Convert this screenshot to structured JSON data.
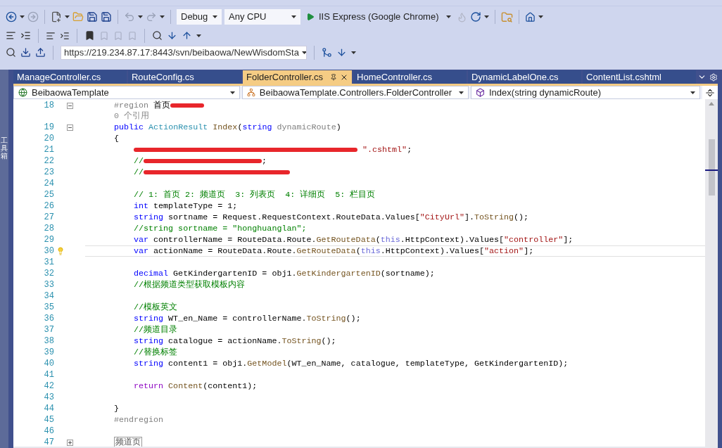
{
  "toolbar": {
    "config": "Debug",
    "platform": "Any CPU",
    "run_target": "IIS Express (Google Chrome)",
    "svn_url": "https://219.234.87.17:8443/svn/beibaowa/NewWisdomSta"
  },
  "side_panel": {
    "label": "工具箱"
  },
  "tabs": [
    {
      "label": "ManageController.cs",
      "selected": false
    },
    {
      "label": "RouteConfig.cs",
      "selected": false
    },
    {
      "label": "FolderController.cs",
      "selected": true
    },
    {
      "label": "HomeController.cs",
      "selected": false
    },
    {
      "label": "DynamicLabelOne.cs",
      "selected": false
    },
    {
      "label": "ContentList.cshtml",
      "selected": false
    }
  ],
  "nav_bar": [
    {
      "kind": "project",
      "label": "BeibaowaTemplate"
    },
    {
      "kind": "class",
      "label": "BeibaowaTemplate.Controllers.FolderController"
    },
    {
      "kind": "method",
      "label": "Index(string dynamicRoute)"
    }
  ],
  "code_lines": [
    {
      "number": "18",
      "expanded": true,
      "tokens": [
        {
          "kind": "pre",
          "text": "#region "
        },
        {
          "kind": "plain",
          "text": "首页"
        },
        {
          "kind": "redaction"
        }
      ]
    },
    {
      "kind": "codelens",
      "text": "0 个引用"
    },
    {
      "number": "19",
      "expanded": true,
      "tokens": [
        {
          "kind": "kw",
          "text": "public "
        },
        {
          "kind": "type",
          "text": "ActionResult "
        },
        {
          "kind": "method",
          "text": "Index"
        },
        {
          "kind": "plain",
          "text": "("
        },
        {
          "kind": "kw",
          "text": "string "
        },
        {
          "kind": "param",
          "text": "dynamicRoute"
        },
        {
          "kind": "plain",
          "text": ")"
        }
      ]
    },
    {
      "number": "20",
      "tokens": [
        {
          "kind": "plain",
          "text": "{"
        }
      ],
      "children": [
        {
          "number": "21",
          "tokens": [
            {
              "kind": "redaction"
            },
            {
              "kind": "str",
              "text": " \".cshtml\""
            },
            {
              "kind": "plain",
              "text": ";"
            }
          ]
        },
        {
          "number": "22",
          "tokens": [
            {
              "kind": "cm",
              "text": "//"
            },
            {
              "kind": "redaction"
            },
            {
              "kind": "plain",
              "text": ";"
            }
          ]
        },
        {
          "number": "23",
          "tokens": [
            {
              "kind": "cm",
              "text": "//"
            },
            {
              "kind": "redaction"
            }
          ]
        },
        {
          "number": "24"
        },
        {
          "number": "25",
          "tokens": [
            {
              "kind": "cm",
              "text": "// 1: 首页 2: 频道页  3: 列表页  4: 详细页  5: 栏目页"
            }
          ]
        },
        {
          "number": "26",
          "tokens": [
            {
              "kind": "kw",
              "text": "int "
            },
            {
              "kind": "plain",
              "text": "templateType = 1;"
            }
          ]
        },
        {
          "number": "27",
          "tokens": [
            {
              "kind": "kw",
              "text": "string "
            },
            {
              "kind": "plain",
              "text": "sortname = Request.RequestContext.RouteData.Values["
            },
            {
              "kind": "str",
              "text": "\"CityUrl\""
            },
            {
              "kind": "plain",
              "text": "]."
            },
            {
              "kind": "method",
              "text": "ToString"
            },
            {
              "kind": "plain",
              "text": "();"
            }
          ]
        },
        {
          "number": "28",
          "tokens": [
            {
              "kind": "cm",
              "text": "//string sortname = \"honghuanglan\";"
            }
          ]
        },
        {
          "number": "29",
          "tokens": [
            {
              "kind": "kw",
              "text": "var "
            },
            {
              "kind": "plain",
              "text": "controllerName = RouteData.Route."
            },
            {
              "kind": "method",
              "text": "GetRouteData"
            },
            {
              "kind": "plain",
              "text": "("
            },
            {
              "kind": "this",
              "text": "this"
            },
            {
              "kind": "plain",
              "text": ".HttpContext).Values["
            },
            {
              "kind": "str",
              "text": "\"controller\""
            },
            {
              "kind": "plain",
              "text": "];"
            }
          ]
        },
        {
          "number": "30",
          "current": true,
          "tokens": [
            {
              "kind": "kw",
              "text": "var "
            },
            {
              "kind": "plain",
              "text": "actionName = RouteData.Route."
            },
            {
              "kind": "method",
              "text": "GetRouteData"
            },
            {
              "kind": "plain",
              "text": "("
            },
            {
              "kind": "this",
              "text": "this"
            },
            {
              "kind": "plain",
              "text": ".HttpContext).Values["
            },
            {
              "kind": "str",
              "text": "\"action\""
            },
            {
              "kind": "plain",
              "text": "];"
            }
          ]
        },
        {
          "number": "31"
        },
        {
          "number": "32",
          "tokens": [
            {
              "kind": "kw",
              "text": "decimal "
            },
            {
              "kind": "plain",
              "text": "GetKindergartenID = obj1."
            },
            {
              "kind": "method",
              "text": "GetKindergartenID"
            },
            {
              "kind": "plain",
              "text": "(sortname);"
            }
          ]
        },
        {
          "number": "33",
          "tokens": [
            {
              "kind": "cm",
              "text": "//根据频道类型获取模板内容"
            }
          ]
        },
        {
          "number": "34"
        },
        {
          "number": "35",
          "tokens": [
            {
              "kind": "cm",
              "text": "//模板英文"
            }
          ]
        },
        {
          "number": "36",
          "tokens": [
            {
              "kind": "kw",
              "text": "string "
            },
            {
              "kind": "plain",
              "text": "WT_en_Name = controllerName."
            },
            {
              "kind": "method",
              "text": "ToString"
            },
            {
              "kind": "plain",
              "text": "();"
            }
          ]
        },
        {
          "number": "37",
          "tokens": [
            {
              "kind": "cm",
              "text": "//频道目录"
            }
          ]
        },
        {
          "number": "38",
          "tokens": [
            {
              "kind": "kw",
              "text": "string "
            },
            {
              "kind": "plain",
              "text": "catalogue = actionName."
            },
            {
              "kind": "method",
              "text": "ToString"
            },
            {
              "kind": "plain",
              "text": "();"
            }
          ]
        },
        {
          "number": "39",
          "tokens": [
            {
              "kind": "cm",
              "text": "//替换标签"
            }
          ]
        },
        {
          "number": "40",
          "tokens": [
            {
              "kind": "kw",
              "text": "string "
            },
            {
              "kind": "plain",
              "text": "content1 = obj1."
            },
            {
              "kind": "method",
              "text": "GetModel"
            },
            {
              "kind": "plain",
              "text": "(WT_en_Name, catalogue, templateType, GetKindergartenID);"
            }
          ]
        },
        {
          "number": "41"
        },
        {
          "number": "42",
          "tokens": [
            {
              "kind": "ctl",
              "text": "return "
            },
            {
              "kind": "method",
              "text": "Content"
            },
            {
              "kind": "plain",
              "text": "(content1);"
            }
          ]
        },
        {
          "number": "43"
        }
      ]
    },
    {
      "number": "44",
      "tokens": [
        {
          "kind": "plain",
          "text": "}"
        }
      ]
    },
    {
      "number": "45",
      "tokens": [
        {
          "kind": "pre",
          "text": "#endregion"
        }
      ]
    },
    {
      "number": "46"
    },
    {
      "number": "47",
      "expanded": false,
      "tokens": [
        {
          "kind": "collapsed",
          "text": "频道页"
        }
      ]
    }
  ]
}
